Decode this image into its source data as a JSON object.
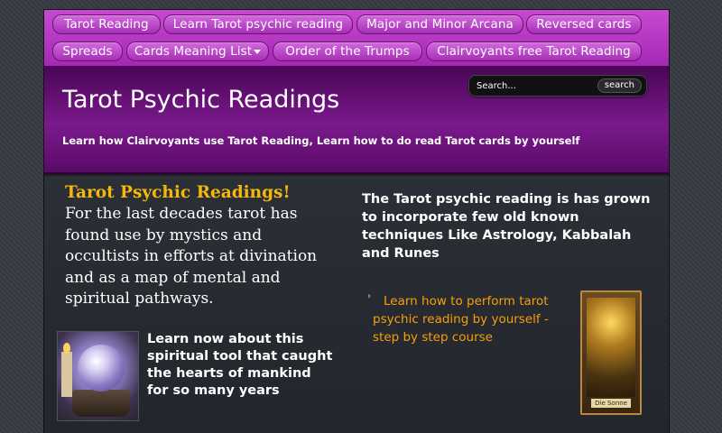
{
  "nav": {
    "items": [
      {
        "label": "Tarot Reading"
      },
      {
        "label": "Learn Tarot psychic reading"
      },
      {
        "label": "Major and Minor Arcana"
      },
      {
        "label": "Reversed cards"
      },
      {
        "label": "Spreads"
      },
      {
        "label": "Cards Meaning List"
      },
      {
        "label": "Order of the Trumps"
      },
      {
        "label": "Clairvoyants free Tarot Reading"
      }
    ]
  },
  "header": {
    "title": "Tarot Psychic Readings",
    "tagline": "Learn how Clairvoyants use Tarot Reading, Learn how to do read Tarot cards by yourself"
  },
  "search": {
    "placeholder": "Search...",
    "button_label": "search"
  },
  "content": {
    "heading": "Tarot Psychic Readings!",
    "intro": "For the last decades tarot has found use by mystics and occultists in efforts at divination and as a map of mental and spiritual pathways.",
    "crystal_text": "Learn now about this spiritual tool that caught the hearts of mankind for so many years",
    "right_text": "The Tarot psychic reading is has grown to incorporate few old known techniques Like Astrology, Kabbalah and Runes",
    "course_bullet": "›",
    "course_link": "Learn how to perform tarot psychic reading by yourself - step by step course",
    "card_label": "Die Sonne"
  },
  "colors": {
    "nav_purple": "#b43bc4",
    "header_purple": "#6a1380",
    "heading_gold": "#f5b80a",
    "link_orange": "#f5a00a"
  }
}
